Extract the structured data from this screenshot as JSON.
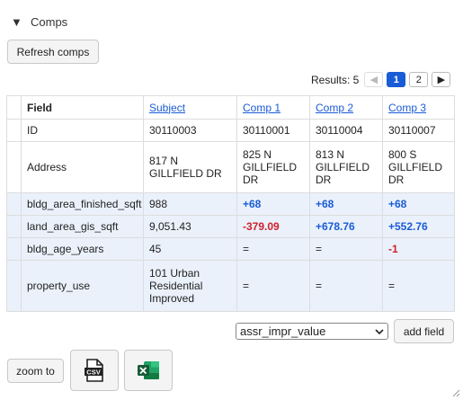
{
  "section": {
    "title": "Comps",
    "caret": "▼"
  },
  "toolbar": {
    "refresh_label": "Refresh comps"
  },
  "pager": {
    "results_label": "Results: 5",
    "prev": "◀",
    "pages": [
      "1",
      "2"
    ],
    "next": "▶",
    "active_page": "1"
  },
  "table": {
    "headers": {
      "field": "Field",
      "subject": "Subject",
      "comp1": "Comp 1",
      "comp2": "Comp 2",
      "comp3": "Comp 3"
    },
    "rows": [
      {
        "field": "ID",
        "subject": "30110003",
        "comp1": "30110001",
        "comp2": "30110004",
        "comp3": "30110007"
      },
      {
        "field": "Address",
        "subject": "817 N GILLFIELD DR",
        "comp1": "825 N GILLFIELD DR",
        "comp2": "813 N GILLFIELD DR",
        "comp3": "800 S GILLFIELD DR"
      },
      {
        "field": "bldg_area_finished_sqft",
        "subject": "988",
        "comp1": "+68",
        "comp2": "+68",
        "comp3": "+68"
      },
      {
        "field": "land_area_gis_sqft",
        "subject": "9,051.43",
        "comp1": "-379.09",
        "comp2": "+678.76",
        "comp3": "+552.76"
      },
      {
        "field": "bldg_age_years",
        "subject": "45",
        "comp1": "=",
        "comp2": "=",
        "comp3": "-1"
      },
      {
        "field": "property_use",
        "subject": "101 Urban Residential Improved",
        "comp1": "=",
        "comp2": "=",
        "comp3": "="
      }
    ]
  },
  "field_picker": {
    "selected": "assr_impr_value",
    "add_label": "add field"
  },
  "footer": {
    "zoom_label": "zoom to"
  },
  "colors": {
    "accent": "#1a5bd6",
    "negative": "#d0202a",
    "highlight_row": "#eaf1fb"
  },
  "icons": {
    "csv": "csv-file-icon",
    "excel": "excel-icon"
  }
}
